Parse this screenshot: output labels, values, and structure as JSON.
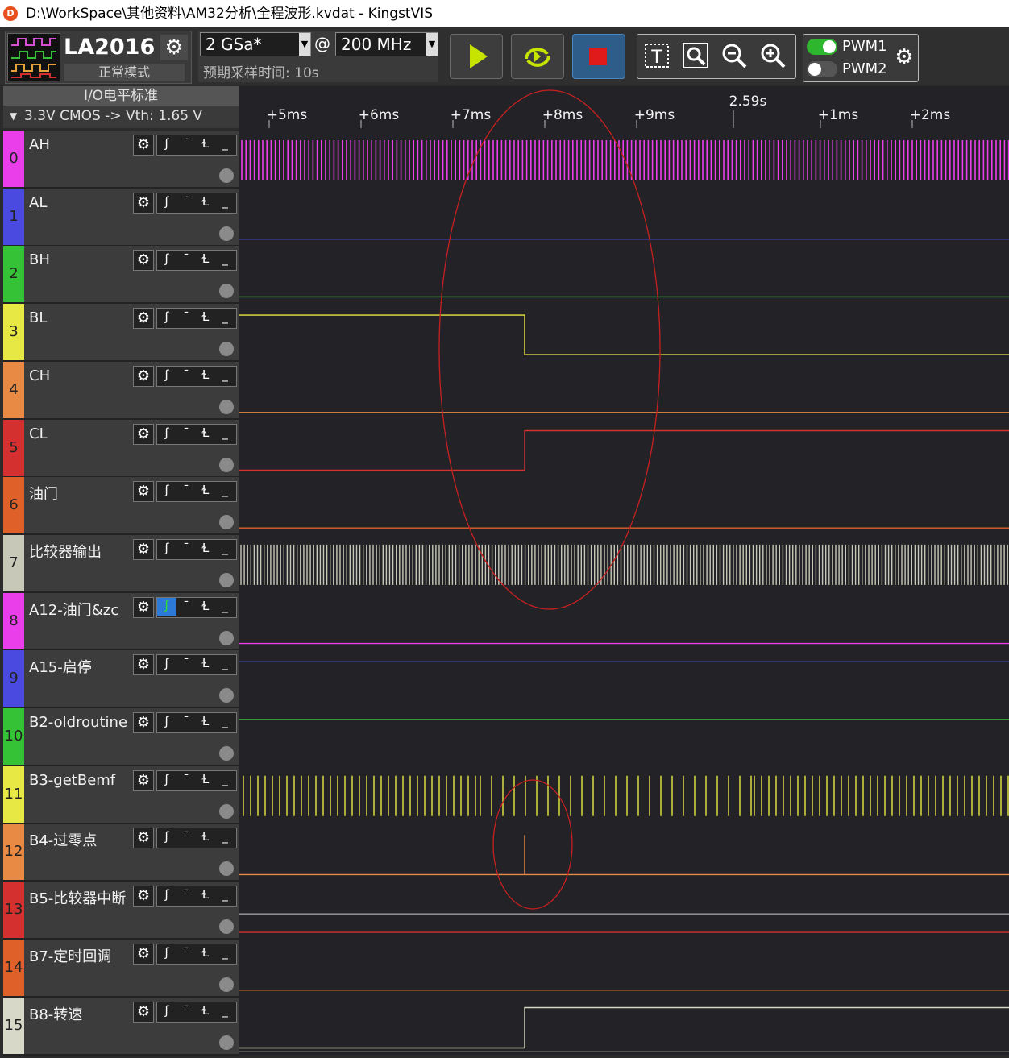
{
  "window": {
    "title": "D:\\WorkSpace\\其他资料\\AM32分析\\全程波形.kvdat - KingstVIS",
    "logo_letter": "D"
  },
  "device": {
    "name": "LA2016",
    "mode": "正常模式"
  },
  "sampling": {
    "rate": "2 GSa*",
    "at": "@",
    "depth": "200 MHz",
    "expected_time": "预期采样时间: 10s"
  },
  "controls": {
    "run": "play-icon",
    "repeat": "repeat-icon",
    "stop": "stop-icon"
  },
  "tools": {
    "text": "T",
    "zoom_fit": "zoom-fit-icon",
    "zoom_out": "zoom-out-icon",
    "zoom_in": "zoom-in-icon"
  },
  "pwm": [
    {
      "label": "PWM1",
      "enabled": true
    },
    {
      "label": "PWM2",
      "enabled": false
    }
  ],
  "io_level": {
    "title": "I/O电平标准",
    "standard": "3.3V CMOS -> Vth: 1.65 V"
  },
  "ruler": {
    "labels": [
      "+5ms",
      "+6ms",
      "+7ms",
      "+8ms",
      "+9ms",
      "2.59s",
      "+1ms",
      "+2ms"
    ]
  },
  "channels": [
    {
      "num": "0",
      "name": "AH",
      "color": "#e93ee9"
    },
    {
      "num": "1",
      "name": "AL",
      "color": "#4a4ae0"
    },
    {
      "num": "2",
      "name": "BH",
      "color": "#36c236"
    },
    {
      "num": "3",
      "name": "BL",
      "color": "#e8e844"
    },
    {
      "num": "4",
      "name": "CH",
      "color": "#e88a44"
    },
    {
      "num": "5",
      "name": "CL",
      "color": "#d43030"
    },
    {
      "num": "6",
      "name": "油门",
      "color": "#e0602a"
    },
    {
      "num": "7",
      "name": "比较器输出",
      "color": "#c8c8b8"
    },
    {
      "num": "8",
      "name": "A12-油门&zc",
      "color": "#e93ee9"
    },
    {
      "num": "9",
      "name": "A15-启停",
      "color": "#4a4ae0"
    },
    {
      "num": "10",
      "name": "B2-oldroutine",
      "color": "#36c236"
    },
    {
      "num": "11",
      "name": "B3-getBemf",
      "color": "#e8e844"
    },
    {
      "num": "12",
      "name": "B4-过零点",
      "color": "#e88a44"
    },
    {
      "num": "13",
      "name": "B5-比较器中断",
      "color": "#d43030"
    },
    {
      "num": "14",
      "name": "B7-定时回调",
      "color": "#e0602a"
    },
    {
      "num": "15",
      "name": "B8-转速",
      "color": "#d8d8c8"
    }
  ],
  "trigger_labels": [
    "rising-edge-icon",
    "high-level-icon",
    "falling-edge-icon",
    "low-level-icon"
  ]
}
